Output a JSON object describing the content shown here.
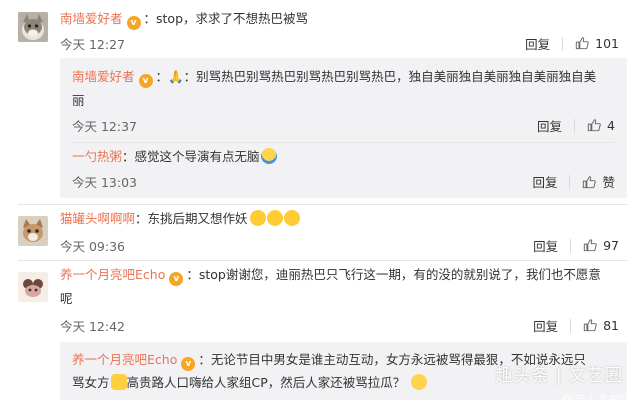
{
  "comments": [
    {
      "user": "南墙爱好者",
      "text": "：stop，求求了不想热巴被骂",
      "time": "今天 12:27",
      "reply_label": "回复",
      "likes": "101",
      "replies": [
        {
          "user": "南墙爱好者",
          "text_line1": "：别骂热巴别骂热巴别骂热巴别骂热巴，独自美丽独自美丽独自美丽独自美",
          "text_line2": "丽",
          "time": "今天 12:37",
          "reply_label": "回复",
          "likes": "4"
        },
        {
          "user": "一勺热粥",
          "text": "：感觉这个导演有点无脑",
          "time": "今天 13:03",
          "reply_label": "回复",
          "likes": "赞"
        }
      ]
    },
    {
      "user": "猫罐头啊啊啊",
      "text": "：东挑后期又想作妖",
      "time": "今天 09:36",
      "reply_label": "回复",
      "likes": "97"
    },
    {
      "user": "养一个月亮吧Echo",
      "text_line1": "：stop谢谢您，迪丽热巴只飞行这一期，有的没的就别说了，我们也不愿意",
      "text_line2": "呢",
      "time": "今天 12:42",
      "reply_label": "回复",
      "likes": "81",
      "replies": [
        {
          "user": "养一个月亮吧Echo",
          "text_line1": "：无论节目中男女是谁主动互动，女方永远被骂得最狠，不如说永远只",
          "text_line2_a": "骂女方",
          "text_line2_b": "高贵路人口嗨给人家组CP，然后人家还被骂拉瓜？"
        }
      ]
    }
  ],
  "watermark": {
    "main": "趣头条 | 文艺圈",
    "sub": "作者 | 冬知道"
  },
  "colors": {
    "username": "#eb7350",
    "reply_bg": "#f2f2f5",
    "badge": "#f6a623"
  }
}
